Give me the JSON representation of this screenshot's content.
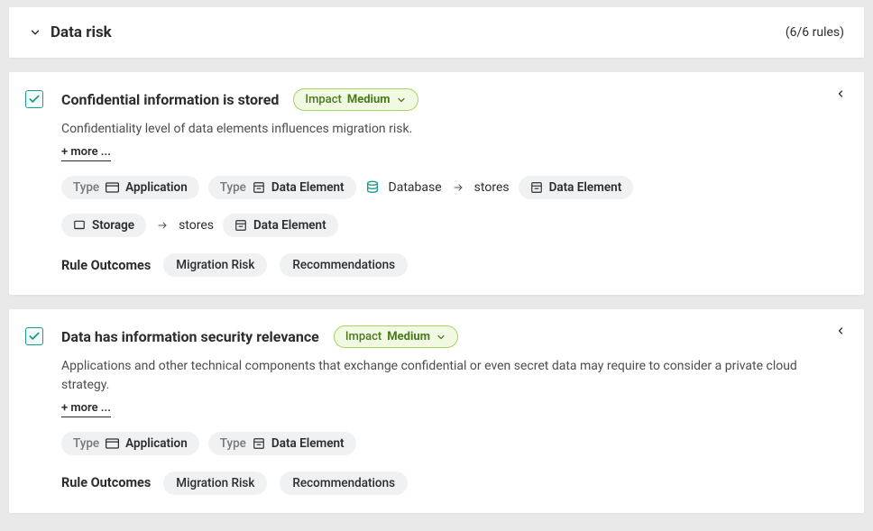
{
  "section": {
    "title": "Data risk",
    "count_text": "(6/6 rules)"
  },
  "labels": {
    "type_prefix": "Type",
    "impact_prefix": "Impact",
    "more": "+ more ...",
    "outcomes": "Rule Outcomes",
    "stores": "stores"
  },
  "types": {
    "application": "Application",
    "data_element": "Data Element",
    "database": "Database",
    "storage": "Storage"
  },
  "outcomes": {
    "migration_risk": "Migration Risk",
    "recommendations": "Recommendations"
  },
  "rules": [
    {
      "title": "Confidential information is stored",
      "impact": "Medium",
      "description": "Confidentiality level of data elements influences migration risk."
    },
    {
      "title": "Data has information security relevance",
      "impact": "Medium",
      "description": "Applications and other technical components that exchange confidential or even secret data may require to consider a private cloud strategy."
    }
  ]
}
